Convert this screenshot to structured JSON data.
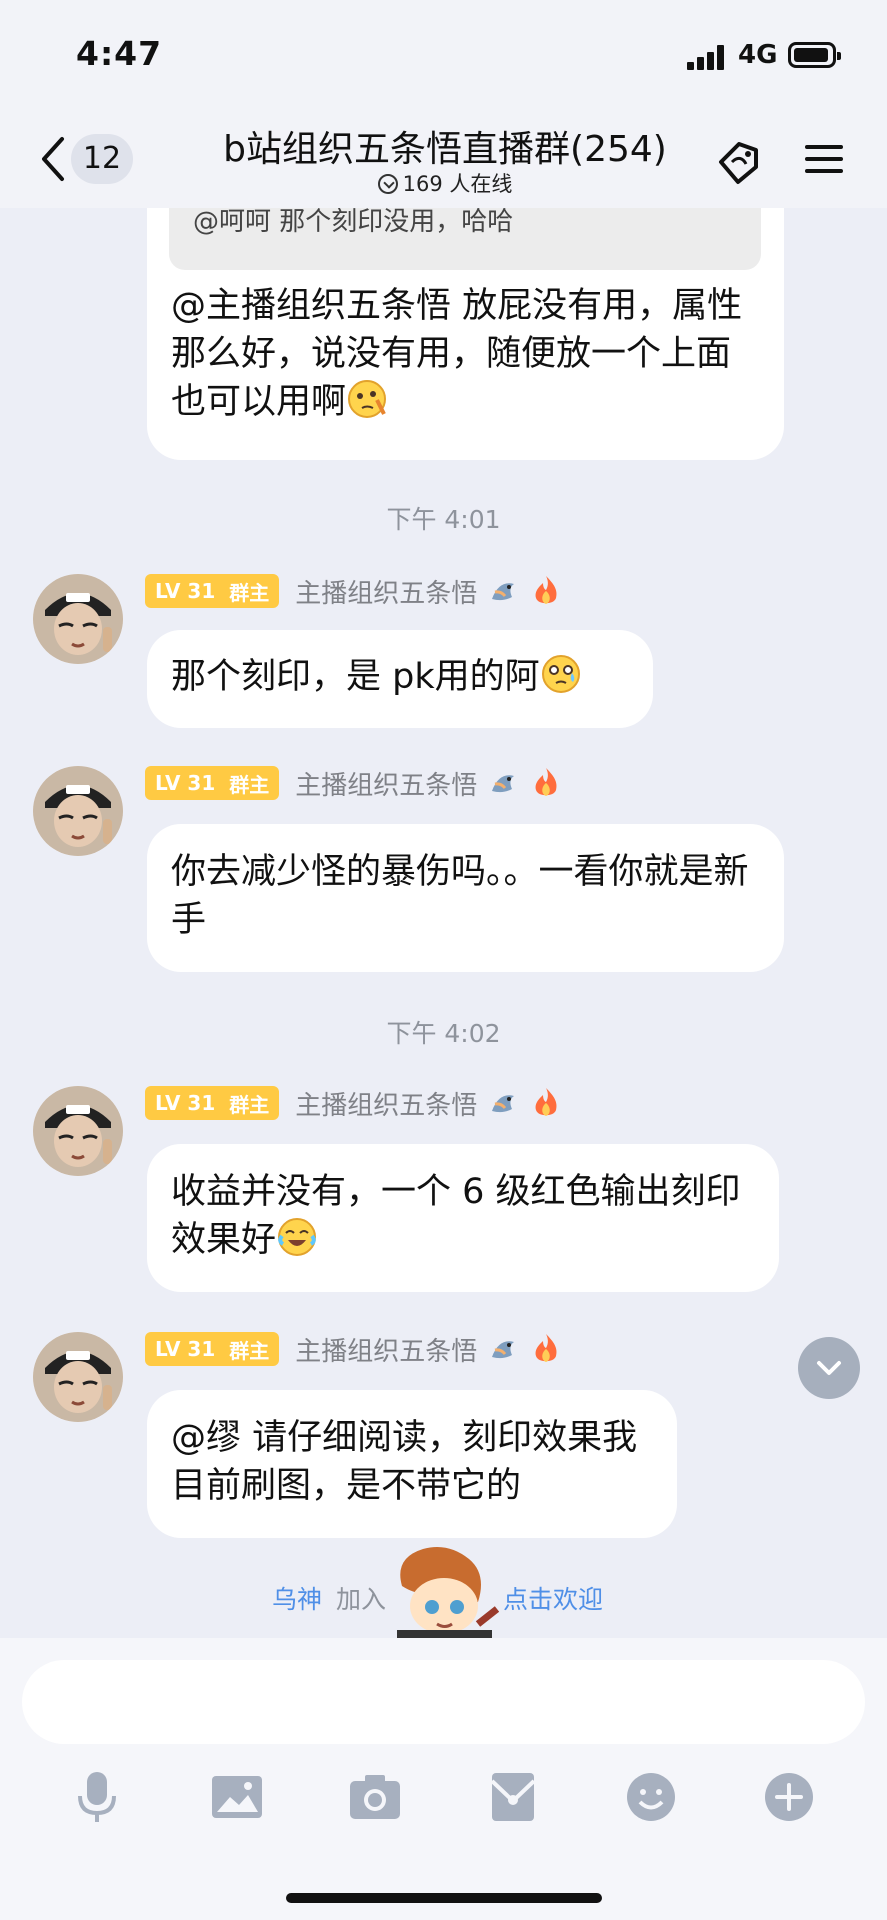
{
  "status_bar": {
    "time": "4:47",
    "network": "4G"
  },
  "header": {
    "back_count": "12",
    "title": "b站组织五条悟直播群(254)",
    "online": "169 人在线"
  },
  "messages": [
    {
      "quote": "@呵呵 那个刻印没用，哈哈",
      "text": "@主播组织五条悟 放屁没有用，属性那么好，说没有用，随便放一个上面也可以用啊",
      "emoji": "thinking-face"
    },
    {
      "time": "下午 4:01"
    },
    {
      "badge_lv": "LV 31",
      "badge_role": "群主",
      "sender": "主播组织五条悟",
      "text": "那个刻印，是 pk用的阿",
      "emoji": "worried-face"
    },
    {
      "badge_lv": "LV 31",
      "badge_role": "群主",
      "sender": "主播组织五条悟",
      "text": "你去减少怪的暴伤吗。。一看你就是新手"
    },
    {
      "time": "下午 4:02"
    },
    {
      "badge_lv": "LV 31",
      "badge_role": "群主",
      "sender": "主播组织五条悟",
      "text": "收益并没有，一个 6 级红色输出刻印效果好",
      "emoji": "laughing-face"
    },
    {
      "badge_lv": "LV 31",
      "badge_role": "群主",
      "sender": "主播组织五条悟",
      "text": "@缪 请仔细阅读，刻印效果我目前刷图，是不带它的"
    }
  ],
  "join_notice": {
    "user": "乌神",
    "action": "加入",
    "welcome": "点击欢迎"
  },
  "toolbar": {
    "icons": [
      "mic-icon",
      "image-icon",
      "camera-icon",
      "red-envelope-icon",
      "emoji-icon",
      "plus-icon"
    ]
  },
  "colors": {
    "background": "#eceef6",
    "badge": "#ffca43",
    "link": "#4f8fe7",
    "timestamp": "#8e939c"
  }
}
